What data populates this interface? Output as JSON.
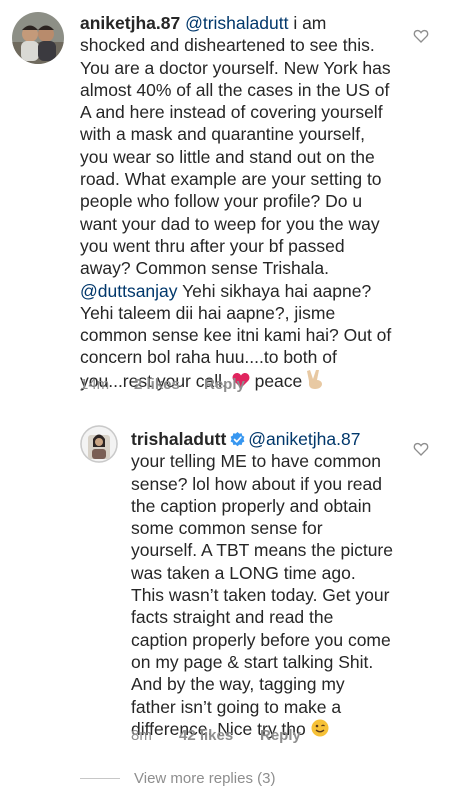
{
  "comment1": {
    "username": "aniketjha.87",
    "mention1": "@trishaladutt",
    "text_a": " i am shocked and disheartened to see this. You are a doctor yourself. New York has almost 40% of all the cases in the US of A and here instead of covering yourself with a mask and quarantine yourself, you wear so little and stand out on the road. What example are your setting to people who follow your profile? Do u want your dad to weep for you the way you went thru after your bf passed away? Common sense Trishala. ",
    "mention2": "@duttsanjay",
    "text_b": " Yehi sikhaya hai aapne? Yehi taleem dii hai aapne?, jisme common sense kee itni kami hai? Out of concern bol raha huu....to both of you...rest your call. ",
    "text_c": " peace ",
    "time": "14m",
    "likes": "2 likes",
    "reply": "Reply"
  },
  "comment2": {
    "username": "trishaladutt",
    "mention1": "@aniketjha.87",
    "text_a": " your telling ME to have common sense? lol how about if you read the caption properly and obtain some common sense for yourself. A TBT means the picture was taken a LONG time ago. This wasn’t taken today. Get your facts straight and read the caption properly before you come on my page & start talking Shit. And by the way, tagging my father isn’t going to make a difference. Nice try tho ",
    "time": "8m",
    "likes": "42 likes",
    "reply": "Reply"
  },
  "view_more": "View more replies (3)",
  "icons": {
    "like": "heart-outline-icon",
    "verified": "verified-badge-icon",
    "emoji_heart": "red-heart-emoji",
    "emoji_peace": "victory-hand-emoji",
    "emoji_wink": "winking-face-emoji"
  },
  "colors": {
    "text": "#262626",
    "mention": "#00376b",
    "meta": "#8e8e8e",
    "verified": "#3897f0",
    "heart_emoji": "#e0245e"
  }
}
